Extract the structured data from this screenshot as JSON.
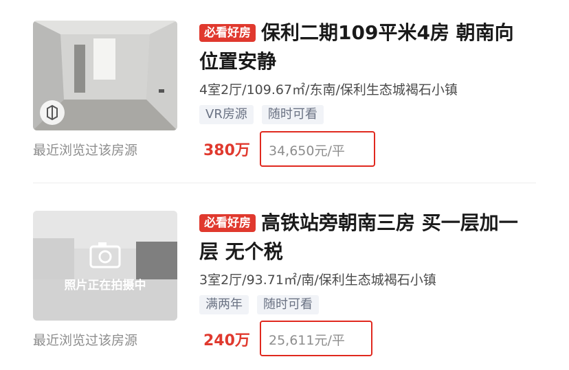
{
  "listings": [
    {
      "badge": "必看好房",
      "title": "保利二期109平米4房 朝南向 位置安静",
      "meta": "4室2厅/109.67㎡/东南/保利生态城褐石小镇",
      "tags": [
        "VR房源",
        "随时可看"
      ],
      "total_price": "380万",
      "unit_price": "34,650元/平",
      "viewed_note": "最近浏览过该房源",
      "thumbnail": "empty-room-photo",
      "vr_icon": "vr-badge-icon"
    },
    {
      "badge": "必看好房",
      "title": "高铁站旁朝南三房 买一层加一层 无个税",
      "meta": "3室2厅/93.71㎡/南/保利生态城褐石小镇",
      "tags": [
        "满两年",
        "随时可看"
      ],
      "total_price": "240万",
      "unit_price": "25,611元/平",
      "viewed_note": "最近浏览过该房源",
      "thumbnail": "photo-placeholder",
      "placeholder_text": "照片正在拍摄中"
    }
  ],
  "colors": {
    "accent_red": "#e0392e",
    "highlight_box": "#e0281e",
    "tag_bg": "#f1f3f7",
    "muted_text": "#8d8d8d"
  }
}
